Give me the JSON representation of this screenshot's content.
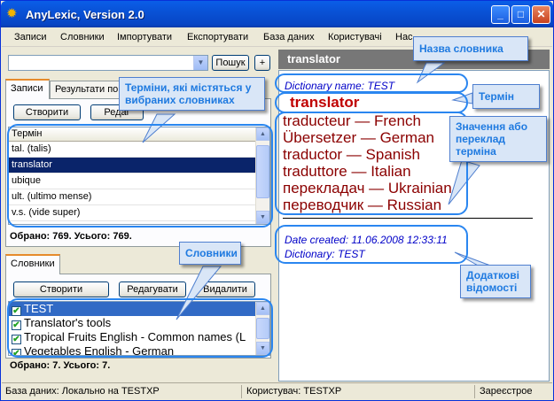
{
  "window": {
    "title": "AnyLexic, Version 2.0",
    "icon": "gear-icon"
  },
  "menu": [
    "Записи",
    "Словники",
    "Імпортувати",
    "Експортувати",
    "База даних",
    "Користувачі",
    "Нас"
  ],
  "search": {
    "value": "",
    "button": "Пошук",
    "add_button": "+"
  },
  "entries_panel": {
    "tabs": [
      "Записи",
      "Результати по"
    ],
    "create_button": "Створити",
    "edit_button": "Редаг",
    "column_header": "Термін",
    "rows": [
      "tal. (talis)",
      "translator",
      "ubique",
      "ult. (ultimo mense)",
      "v.s. (vide super)"
    ],
    "selected_index": 1,
    "count_text": "Обрано: 769. Усього: 769."
  },
  "dictionaries_panel": {
    "tab": "Словники",
    "create_button": "Створити",
    "edit_button": "Редагувати",
    "delete_button": "Видалити",
    "rows": [
      "TEST",
      "Translator's tools",
      "Tropical Fruits English - Common names (L",
      "Vegetables English - German"
    ],
    "selected_index": 0,
    "count_text": "Обрано: 7. Усього: 7."
  },
  "article": {
    "header": "translator",
    "dictionary_line": "Dictionary name: TEST",
    "term": "translator",
    "translations": [
      "traducteur — French",
      "Übersetzer — German",
      "traductor — Spanish",
      "traduttore — Italian",
      "перекладач — Ukrainian",
      "переводчик — Russian"
    ],
    "date_line": "Date created: 11.06.2008 12:33:11",
    "dict_line": "Dictionary: TEST"
  },
  "statusbar": {
    "database": "База даних: Локально на TESTXP",
    "user": "Користувач: TESTXP",
    "registered": "Зареєстрое"
  },
  "callouts": {
    "terms": "Терміни, які містяться у вибраних словниках",
    "dictionaries": "Словники",
    "dict_name": "Назва словника",
    "term": "Термін",
    "meaning": "Значення або переклад терміна",
    "extra": "Додаткові відомості"
  },
  "colors": {
    "highlight": "#2a86f0",
    "callout_text": "#1f7ae0",
    "selection": "#0a246a",
    "term": "#c00000",
    "translation": "#8b0000",
    "meta": "#0000c8"
  }
}
